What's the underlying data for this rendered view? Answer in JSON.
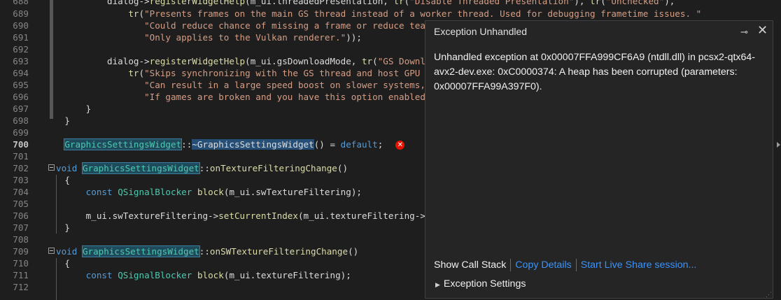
{
  "editor": {
    "lines": [
      {
        "n": "688",
        "code": "            dialog->registerWidgetHelp(m_ui.threadedPresentation, tr(\"Disable Threaded Presentation\"), tr(\"Unchecked\"),"
      },
      {
        "n": "689",
        "code": "                tr(\"Presents frames on the main GS thread instead of a worker thread. Used for debugging frametime issues. \""
      },
      {
        "n": "690",
        "code": "                   \"Could reduce chance of missing a frame or reduce tea"
      },
      {
        "n": "691",
        "code": "                   \"Only applies to the Vulkan renderer.\"));"
      },
      {
        "n": "692",
        "code": ""
      },
      {
        "n": "693",
        "code": "            dialog->registerWidgetHelp(m_ui.gsDownloadMode, tr(\"GS Downl"
      },
      {
        "n": "694",
        "code": "                tr(\"Skips synchronizing with the GS thread and host GPU"
      },
      {
        "n": "695",
        "code": "                   \"Can result in a large speed boost on slower systems,"
      },
      {
        "n": "696",
        "code": "                   \"If games are broken and you have this option enabled"
      },
      {
        "n": "697",
        "code": "        }"
      },
      {
        "n": "698",
        "code": "    }"
      },
      {
        "n": "699",
        "code": ""
      },
      {
        "n": "700",
        "code": "    GraphicsSettingsWidget::~GraphicsSettingsWidget() = default;"
      },
      {
        "n": "701",
        "code": ""
      },
      {
        "n": "702",
        "code": "void GraphicsSettingsWidget::onTextureFilteringChange()"
      },
      {
        "n": "703",
        "code": "    {"
      },
      {
        "n": "704",
        "code": "        const QSignalBlocker block(m_ui.swTextureFiltering);"
      },
      {
        "n": "705",
        "code": ""
      },
      {
        "n": "706",
        "code": "        m_ui.swTextureFiltering->setCurrentIndex(m_ui.textureFiltering->"
      },
      {
        "n": "707",
        "code": "    }"
      },
      {
        "n": "708",
        "code": ""
      },
      {
        "n": "709",
        "code": "void GraphicsSettingsWidget::onSWTextureFilteringChange()"
      },
      {
        "n": "710",
        "code": "    {"
      },
      {
        "n": "711",
        "code": "        const QSignalBlocker block(m_ui.textureFiltering);"
      },
      {
        "n": "712",
        "code": ""
      }
    ],
    "current_line": "700",
    "error_icon": "error-icon",
    "error_color": "#e51400"
  },
  "popup": {
    "title": "Exception Unhandled",
    "pin_icon": "pin-icon",
    "close_icon": "close-icon",
    "message": "Unhandled exception at 0x00007FFA999CF6A9 (ntdll.dll) in pcsx2-qtx64-avx2-dev.exe: 0xC0000374: A heap has been corrupted (parameters: 0x00007FFA99A397F0).",
    "links": {
      "show_call_stack": "Show Call Stack",
      "copy_details": "Copy Details",
      "live_share": "Start Live Share session..."
    },
    "settings_label": "Exception Settings",
    "link_color": "#3794ff"
  }
}
